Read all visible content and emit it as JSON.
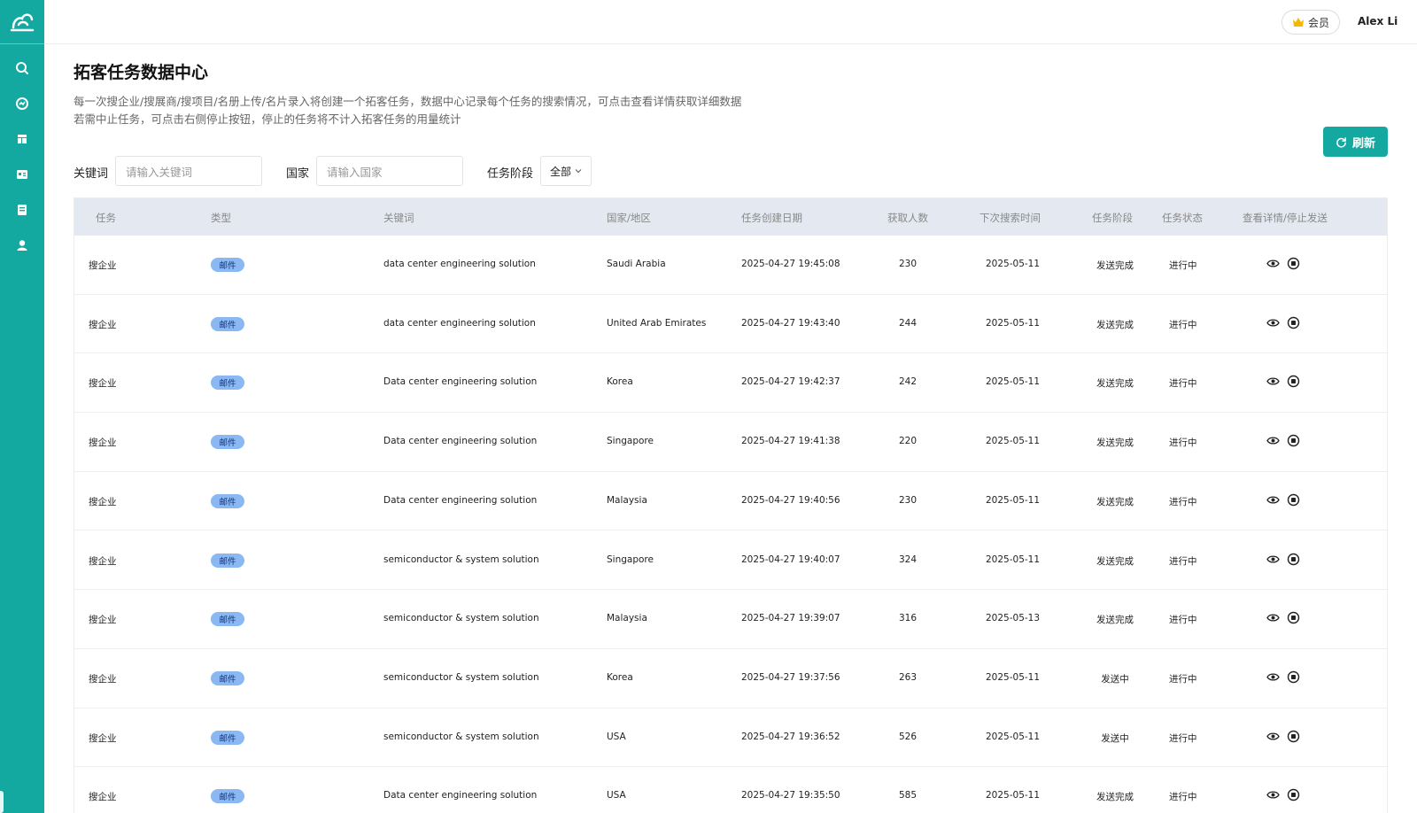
{
  "sidebar": {
    "icons": [
      "logo-icon",
      "search-icon",
      "chart-icon",
      "layout-icon",
      "card-icon",
      "book-icon",
      "user-icon"
    ]
  },
  "header": {
    "member_label": "会员",
    "username": "Alex Li"
  },
  "page": {
    "title": "拓客任务数据中心",
    "desc_line1": "每一次搜企业/搜展商/搜项目/名册上传/名片录入将创建一个拓客任务，数据中心记录每个任务的搜索情况，可点击查看详情获取详细数据",
    "desc_line2": "若需中止任务，可点击右侧停止按钮，停止的任务将不计入拓客任务的用量统计",
    "refresh_label": "刷新"
  },
  "filters": {
    "keyword_label": "关键词",
    "keyword_placeholder": "请输入关键词",
    "country_label": "国家",
    "country_placeholder": "请输入国家",
    "stage_label": "任务阶段",
    "stage_value": "全部"
  },
  "table": {
    "headers": [
      "任务",
      "类型",
      "关键词",
      "国家/地区",
      "任务创建日期",
      "获取人数",
      "下次搜索时间",
      "任务阶段",
      "任务状态",
      "查看详情/停止发送"
    ],
    "rows": [
      {
        "task": "搜企业",
        "type": "邮件",
        "keyword": "data center engineering solution",
        "country": "Saudi Arabia",
        "created": "2025-04-27 19:45:08",
        "count": "230",
        "next": "2025-05-11",
        "stage": "发送完成",
        "status": "进行中"
      },
      {
        "task": "搜企业",
        "type": "邮件",
        "keyword": "data center engineering solution",
        "country": "United Arab Emirates",
        "created": "2025-04-27 19:43:40",
        "count": "244",
        "next": "2025-05-11",
        "stage": "发送完成",
        "status": "进行中"
      },
      {
        "task": "搜企业",
        "type": "邮件",
        "keyword": "Data center engineering solution",
        "country": "Korea",
        "created": "2025-04-27 19:42:37",
        "count": "242",
        "next": "2025-05-11",
        "stage": "发送完成",
        "status": "进行中"
      },
      {
        "task": "搜企业",
        "type": "邮件",
        "keyword": "Data center engineering solution",
        "country": "Singapore",
        "created": "2025-04-27 19:41:38",
        "count": "220",
        "next": "2025-05-11",
        "stage": "发送完成",
        "status": "进行中"
      },
      {
        "task": "搜企业",
        "type": "邮件",
        "keyword": "Data center engineering solution",
        "country": "Malaysia",
        "created": "2025-04-27 19:40:56",
        "count": "230",
        "next": "2025-05-11",
        "stage": "发送完成",
        "status": "进行中"
      },
      {
        "task": "搜企业",
        "type": "邮件",
        "keyword": "semiconductor & system solution",
        "country": "Singapore",
        "created": "2025-04-27 19:40:07",
        "count": "324",
        "next": "2025-05-11",
        "stage": "发送完成",
        "status": "进行中"
      },
      {
        "task": "搜企业",
        "type": "邮件",
        "keyword": "semiconductor & system solution",
        "country": "Malaysia",
        "created": "2025-04-27 19:39:07",
        "count": "316",
        "next": "2025-05-13",
        "stage": "发送完成",
        "status": "进行中"
      },
      {
        "task": "搜企业",
        "type": "邮件",
        "keyword": "semiconductor & system solution",
        "country": "Korea",
        "created": "2025-04-27 19:37:56",
        "count": "263",
        "next": "2025-05-11",
        "stage": "发送中",
        "status": "进行中"
      },
      {
        "task": "搜企业",
        "type": "邮件",
        "keyword": "semiconductor & system solution",
        "country": "USA",
        "created": "2025-04-27 19:36:52",
        "count": "526",
        "next": "2025-05-11",
        "stage": "发送中",
        "status": "进行中"
      },
      {
        "task": "搜企业",
        "type": "邮件",
        "keyword": "Data center engineering solution",
        "country": "USA",
        "created": "2025-04-27 19:35:50",
        "count": "585",
        "next": "2025-05-11",
        "stage": "发送完成",
        "status": "进行中"
      }
    ]
  },
  "colors": {
    "brand": "#13a8a0",
    "tag_bg": "#8ab8f2",
    "header_bg": "#e4e8f0"
  }
}
